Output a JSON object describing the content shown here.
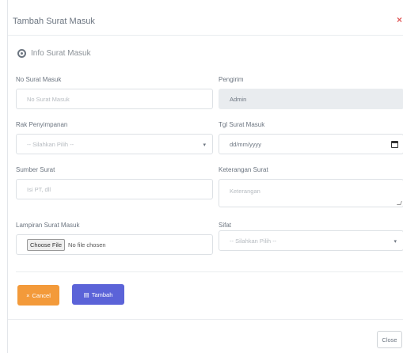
{
  "modal": {
    "title": "Tambah Surat Masuk",
    "close_icon": "close-icon",
    "section_label": "Info Surat Masuk"
  },
  "form": {
    "no_surat": {
      "label": "No Surat Masuk",
      "placeholder": "No Surat Masuk"
    },
    "pengirim": {
      "label": "Pengirim",
      "value": "Admin"
    },
    "rak": {
      "label": "Rak Penyimpanan",
      "value": "-- Silahkan Pilih --"
    },
    "tgl": {
      "label": "Tgl Surat Masuk",
      "value": "dd/mm/yyyy"
    },
    "sumber": {
      "label": "Sumber Surat",
      "placeholder": "Isi PT, dll"
    },
    "keterangan": {
      "label": "Keterangan Surat",
      "placeholder": "Keterangan"
    },
    "lampiran": {
      "label": "Lampiran Surat Masuk",
      "choose": "Choose File",
      "status": "No file chosen"
    },
    "sifat": {
      "label": "Sifat",
      "value": "-- Silahkan Pilih --"
    }
  },
  "buttons": {
    "cancel": "Cancel",
    "add": "Tambah",
    "close": "Close"
  }
}
